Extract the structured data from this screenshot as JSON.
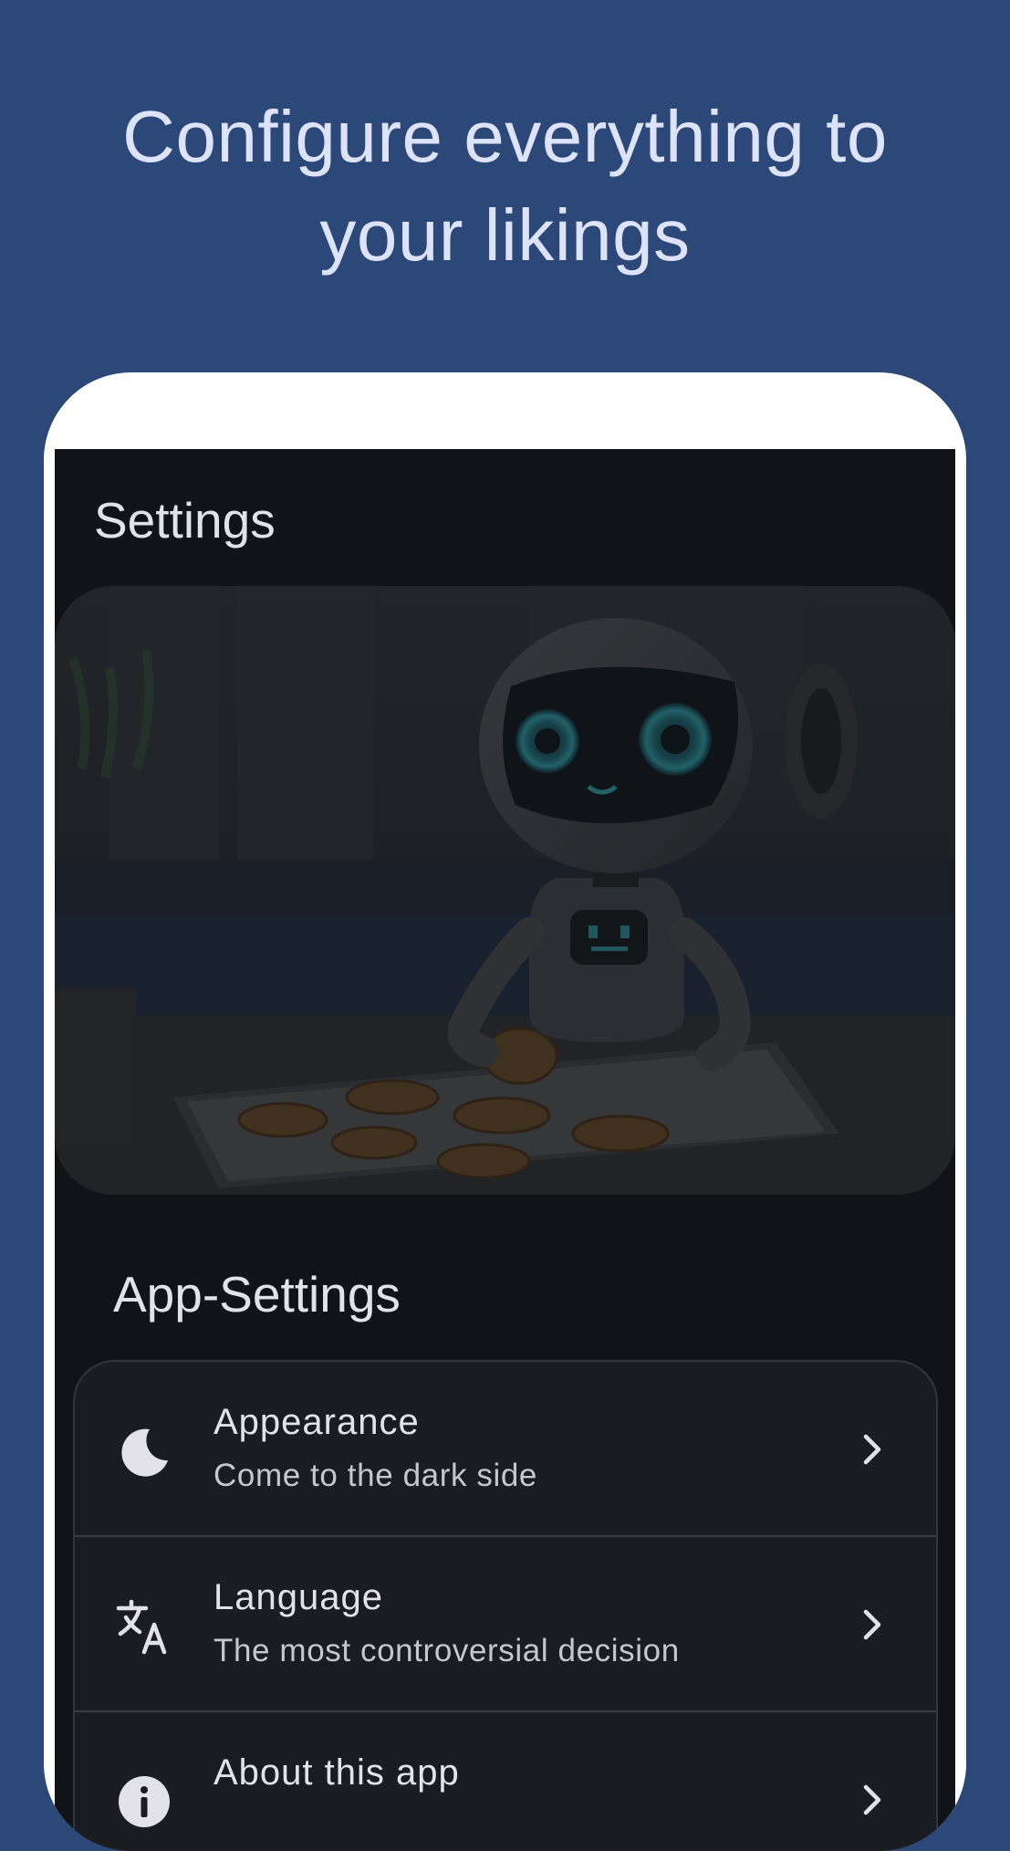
{
  "headline": {
    "line1": "Configure everything to",
    "line2": "your likings"
  },
  "screen": {
    "title": "Settings"
  },
  "hero_image": {
    "description_icon": "robot-baking-cookies-image"
  },
  "section": {
    "title": "App-Settings"
  },
  "settings_items": [
    {
      "title": "Appearance",
      "subtitle": "Come to the dark side",
      "icon": "moon-icon"
    },
    {
      "title": "Language",
      "subtitle": "The most controversial decision",
      "icon": "translate-icon"
    },
    {
      "title": "About this app",
      "subtitle": "",
      "icon": "info-icon"
    }
  ],
  "colors": {
    "background": "#2b4878",
    "headline": "#dde3fb",
    "screen_bg": "#121318",
    "card_bg": "#1b1c21",
    "text_primary": "#e3e2e9",
    "text_secondary": "#c5c6d0"
  }
}
